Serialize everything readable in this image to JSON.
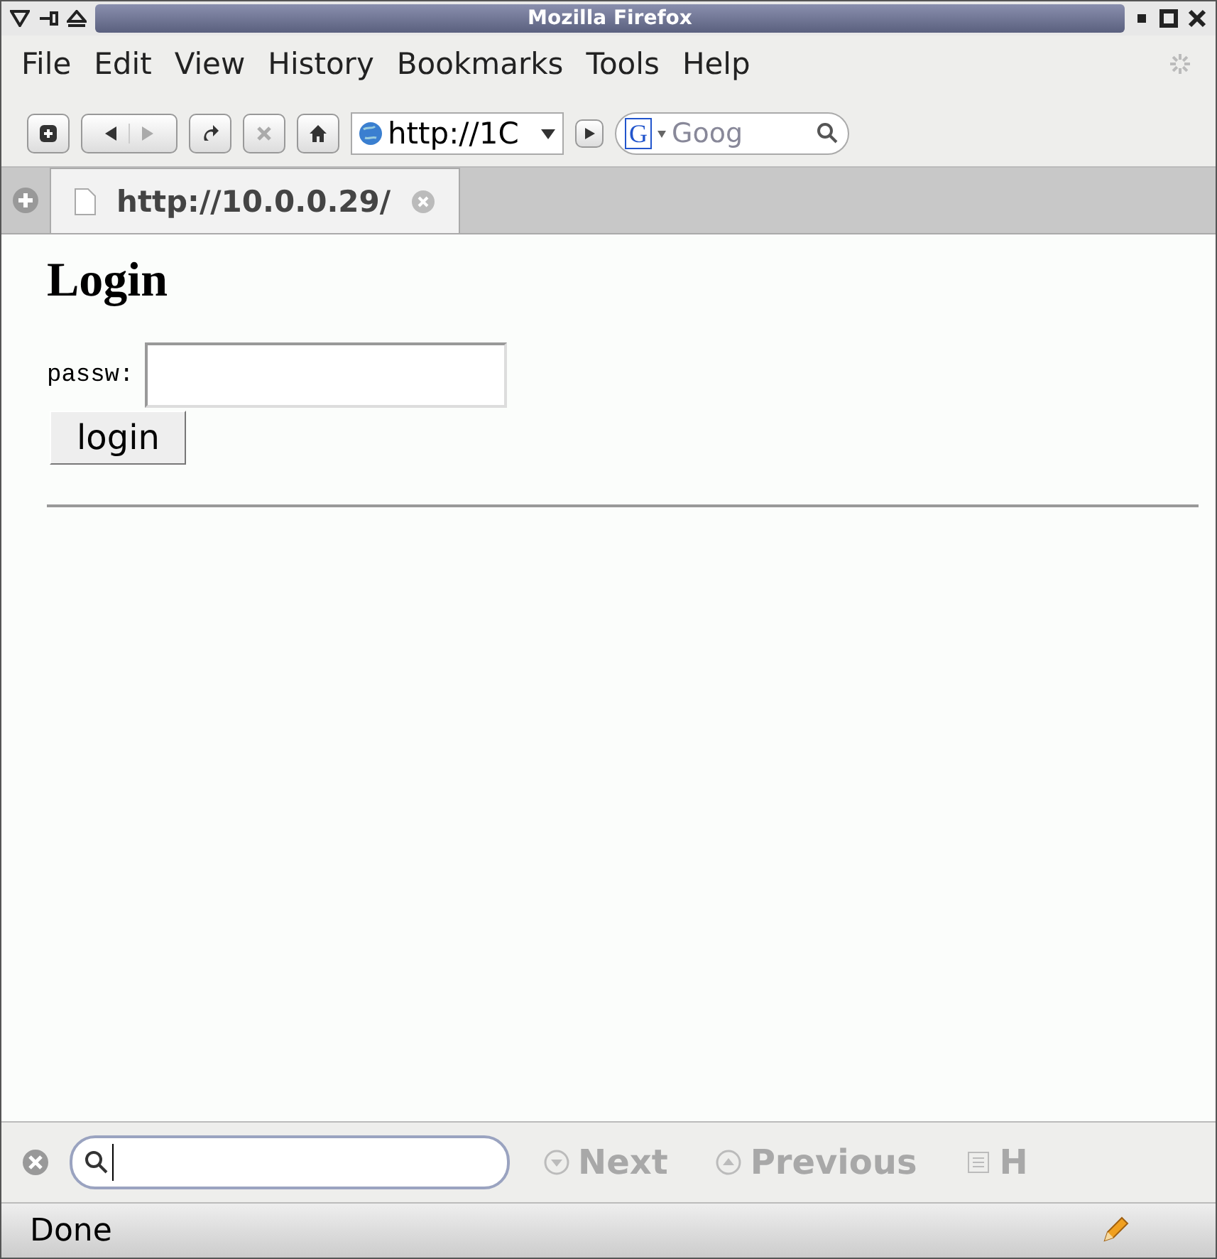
{
  "window": {
    "title": "Mozilla Firefox"
  },
  "menu": [
    {
      "label": "File"
    },
    {
      "label": "Edit"
    },
    {
      "label": "View"
    },
    {
      "label": "History"
    },
    {
      "label": "Bookmarks"
    },
    {
      "label": "Tools"
    },
    {
      "label": "Help"
    }
  ],
  "toolbar": {
    "url": "http://1C",
    "search_placeholder": "Goog",
    "search_engine": "G"
  },
  "tabs": [
    {
      "label": "http://10.0.0.29/",
      "selected": true
    }
  ],
  "page": {
    "heading": "Login",
    "field_label": "passw:",
    "button": "login"
  },
  "findbar": {
    "buttons": [
      {
        "label": "Next",
        "disabled": true
      },
      {
        "label": "Previous",
        "disabled": true
      },
      {
        "label": "H",
        "disabled": true
      }
    ]
  },
  "status": {
    "text": "Done"
  }
}
